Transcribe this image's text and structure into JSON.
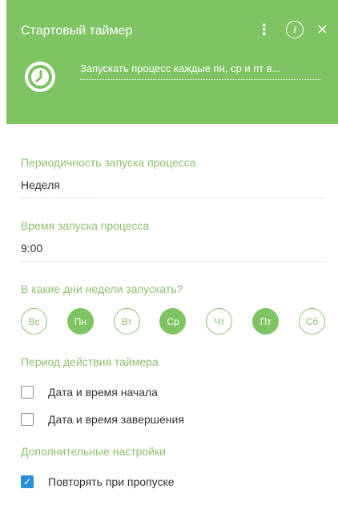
{
  "header": {
    "title": "Стартовый таймер",
    "more_icon": "more-vertical-icon",
    "info_icon": "info-icon",
    "close_icon": "close-icon",
    "process_icon": "clock-icon",
    "summary": "Запускать процесс каждые пн, ср и пт в...",
    "accent_color": "#7ec463"
  },
  "frequency": {
    "label": "Периодичность запуска процесса",
    "value": "Неделя"
  },
  "time": {
    "label": "Время запуска процесса",
    "value": "9:00"
  },
  "days": {
    "label": "В какие дни недели запускать?",
    "items": [
      {
        "label": "Вс",
        "active": false
      },
      {
        "label": "Пн",
        "active": true
      },
      {
        "label": "Вт",
        "active": false
      },
      {
        "label": "Ср",
        "active": true
      },
      {
        "label": "Чт",
        "active": false
      },
      {
        "label": "Пт",
        "active": true
      },
      {
        "label": "Сб",
        "active": false
      }
    ]
  },
  "period": {
    "label": "Период действия таймера",
    "start_label": "Дата и время начала",
    "start_checked": false,
    "end_label": "Дата и время завершения",
    "end_checked": false
  },
  "additional": {
    "label": "Дополнительные настройки",
    "repeat_label": "Повторять при пропуске",
    "repeat_checked": true
  }
}
